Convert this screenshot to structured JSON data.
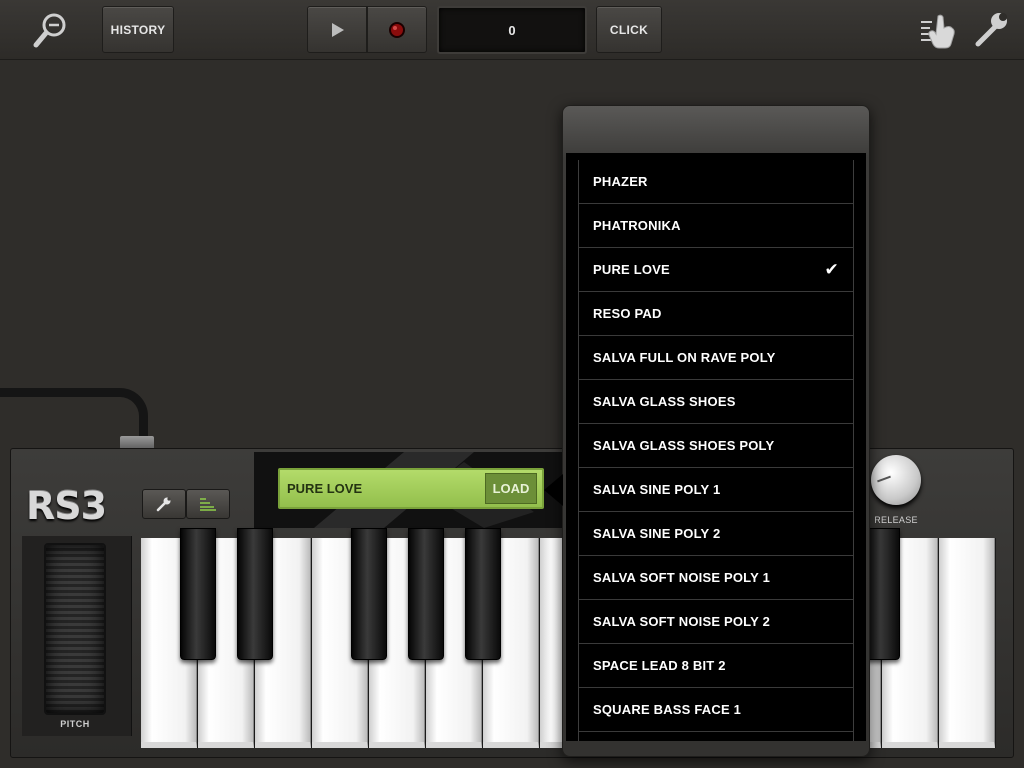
{
  "toolbar": {
    "history_label": "HISTORY",
    "counter_value": "0",
    "click_label": "CLICK",
    "icons": [
      "zoom-out-icon",
      "play-icon",
      "record-icon",
      "touch-gesture-icon",
      "wrench-icon"
    ]
  },
  "synth": {
    "logo": "RS3",
    "patch_name": "PURE LOVE",
    "load_label": "LOAD",
    "pitch_label": "PITCH",
    "release_label": "RELEASE",
    "accent_color": "#9cc955"
  },
  "patch_list": {
    "selected": "PURE LOVE",
    "items": [
      "PHAZER",
      "PHATRONIKA",
      "PURE LOVE",
      "RESO PAD",
      "SALVA FULL ON RAVE POLY",
      "SALVA GLASS SHOES",
      "SALVA GLASS SHOES POLY",
      "SALVA SINE POLY 1",
      "SALVA SINE POLY 2",
      "SALVA SOFT NOISE POLY 1",
      "SALVA SOFT NOISE POLY 2",
      "SPACE LEAD 8 BIT 2",
      "SQUARE BASS FACE 1"
    ]
  }
}
